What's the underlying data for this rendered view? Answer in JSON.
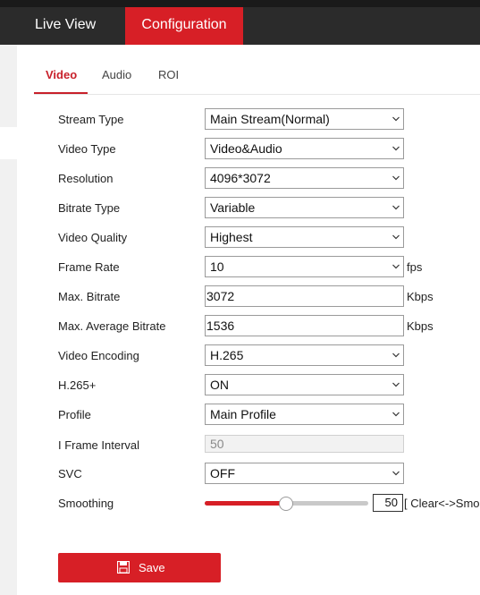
{
  "nav": {
    "live_view": "Live View",
    "configuration": "Configuration"
  },
  "tabs": [
    "Video",
    "Audio",
    "ROI"
  ],
  "form": {
    "stream_type": {
      "label": "Stream Type",
      "value": "Main Stream(Normal)"
    },
    "video_type": {
      "label": "Video Type",
      "value": "Video&Audio"
    },
    "resolution": {
      "label": "Resolution",
      "value": "4096*3072"
    },
    "bitrate_type": {
      "label": "Bitrate Type",
      "value": "Variable"
    },
    "video_quality": {
      "label": "Video Quality",
      "value": "Highest"
    },
    "frame_rate": {
      "label": "Frame Rate",
      "value": "10",
      "unit": "fps"
    },
    "max_bitrate": {
      "label": "Max. Bitrate",
      "value": "3072",
      "unit": "Kbps"
    },
    "max_avg_bitrate": {
      "label": "Max. Average Bitrate",
      "value": "1536",
      "unit": "Kbps"
    },
    "video_encoding": {
      "label": "Video Encoding",
      "value": "H.265"
    },
    "h265plus": {
      "label": "H.265+",
      "value": "ON"
    },
    "profile": {
      "label": "Profile",
      "value": "Main Profile"
    },
    "i_frame_interval": {
      "label": "I Frame Interval",
      "value": "50"
    },
    "svc": {
      "label": "SVC",
      "value": "OFF"
    },
    "smoothing": {
      "label": "Smoothing",
      "value": "50",
      "hint": "[ Clear<->Smoo"
    }
  },
  "save_label": "Save",
  "colors": {
    "accent": "#d71f26",
    "topbar": "#2b2b2b"
  }
}
